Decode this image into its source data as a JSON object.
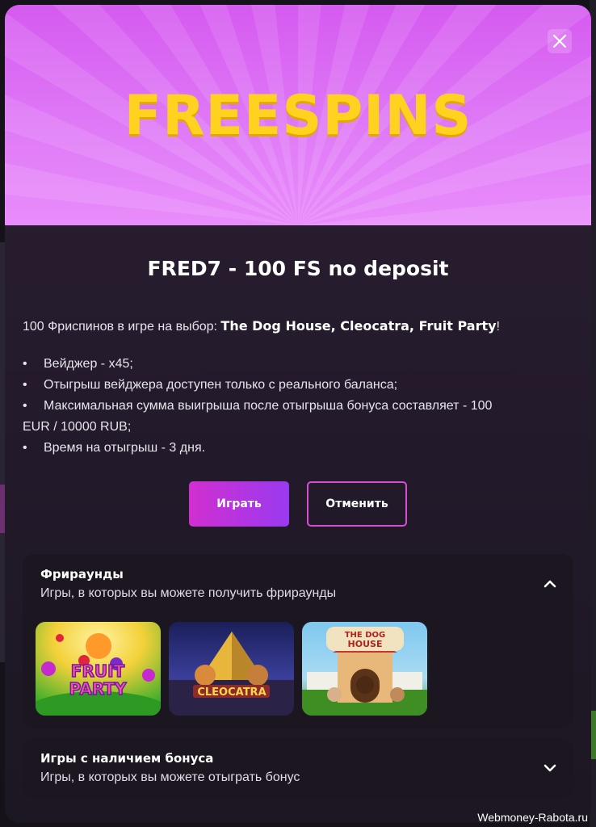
{
  "banner": {
    "title": "FREESPINS"
  },
  "close": {
    "icon": "close-icon"
  },
  "offer": {
    "heading": "FRED7 - 100 FS no deposit",
    "intro_text": "100 Фриспинов в игре на выбор: ",
    "intro_games": "The Dog House, Cleocatra, Fruit Party",
    "intro_end": "!",
    "rules": [
      "Вейджер - x45;",
      "Отыгрыш вейджера доступен только с реального баланса;",
      "Максимальная сумма выигрыша после отыгрыша бонуса составляет - 100",
      "EUR / 10000 RUB;",
      "Время на отыгрыш - 3 дня."
    ]
  },
  "actions": {
    "play_label": "Играть",
    "cancel_label": "Отменить"
  },
  "freerounds": {
    "title": "Фрираунды",
    "subtitle": "Игры, в которых вы можете получить фрираунды",
    "icon": "chevron-up-icon",
    "games": [
      {
        "name": "Fruit Party"
      },
      {
        "name": "Cleocatra"
      },
      {
        "name": "The Dog House"
      }
    ]
  },
  "bonus_games": {
    "title": "Игры с наличием бонуса",
    "subtitle": "Игры, в которых вы можете отыграть бонус",
    "icon": "chevron-down-icon"
  },
  "watermark": "Webmoney-Rabota.ru",
  "colors": {
    "banner": "#e07cf7",
    "banner_text": "#ffd21f",
    "accent": "#d12fd0",
    "panel": "#1c1620"
  }
}
